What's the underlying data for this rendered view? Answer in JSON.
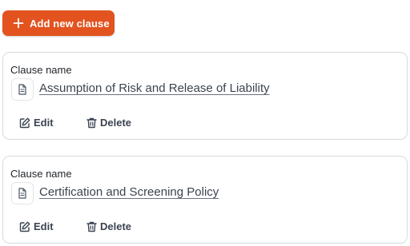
{
  "toolbar": {
    "add_label": "Add new clause",
    "add_icon": "plus-icon",
    "accent": "#e2531f"
  },
  "clauses": [
    {
      "field_label": "Clause name",
      "name": "Assumption of Risk and Release of Liability",
      "doc_icon": "document-icon",
      "edit_label": "Edit",
      "edit_icon": "edit-icon",
      "delete_label": "Delete",
      "delete_icon": "trash-icon"
    },
    {
      "field_label": "Clause name",
      "name": "Certification and Screening Policy",
      "doc_icon": "document-icon",
      "edit_label": "Edit",
      "edit_icon": "edit-icon",
      "delete_label": "Delete",
      "delete_icon": "trash-icon"
    }
  ]
}
